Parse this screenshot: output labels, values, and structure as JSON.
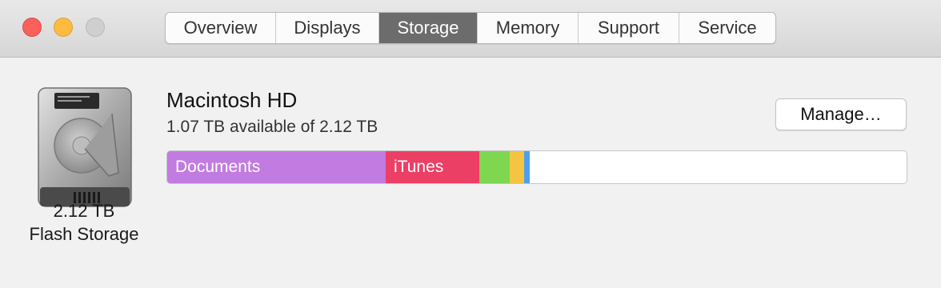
{
  "window": {
    "traffic_lights": {
      "close_color": "#fc605b",
      "minimize_color": "#fdbc40",
      "maximize_color": "#cfcfcf"
    }
  },
  "tabs": [
    {
      "label": "Overview",
      "active": false
    },
    {
      "label": "Displays",
      "active": false
    },
    {
      "label": "Storage",
      "active": true
    },
    {
      "label": "Memory",
      "active": false
    },
    {
      "label": "Support",
      "active": false
    },
    {
      "label": "Service",
      "active": false
    }
  ],
  "drive": {
    "icon": "hard-drive-icon",
    "size": "2.12 TB",
    "type": "Flash Storage"
  },
  "disk": {
    "name": "Macintosh HD",
    "available": "1.07 TB available of 2.12 TB",
    "manage_label": "Manage…"
  },
  "usage": {
    "segments": [
      {
        "label": "Documents",
        "color": "#c27be0",
        "fraction": 0.295
      },
      {
        "label": "iTunes",
        "color": "#ec3f66",
        "fraction": 0.127
      },
      {
        "label": "",
        "color": "#7fd64f",
        "fraction": 0.041
      },
      {
        "label": "",
        "color": "#f6c443",
        "fraction": 0.019
      },
      {
        "label": "",
        "color": "#4da0f0",
        "fraction": 0.008
      }
    ],
    "free_color": "#ffffff"
  }
}
